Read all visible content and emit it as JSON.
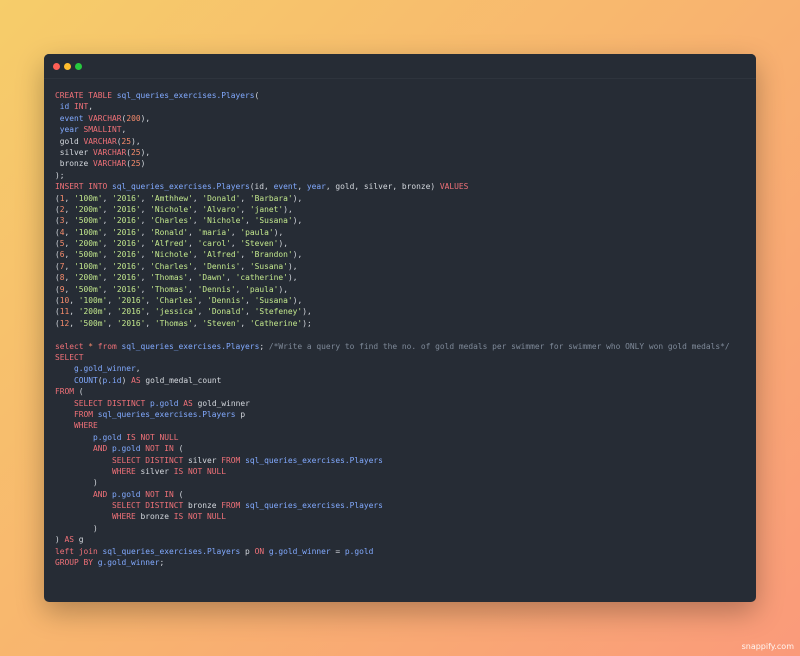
{
  "window": {
    "controls": [
      {
        "name": "close-dot",
        "color": "#ff5f56"
      },
      {
        "name": "minimize-dot",
        "color": "#ffbd2e"
      },
      {
        "name": "zoom-dot",
        "color": "#27c93f"
      }
    ]
  },
  "palette": {
    "k": "#f07178",
    "i": "#82aaff",
    "t": "#d4d8de",
    "s": "#c3e88d",
    "n": "#f78c6c",
    "c": "#7f8a99"
  },
  "code_lines": [
    [
      [
        "k",
        "CREATE TABLE "
      ],
      [
        "i",
        "sql_queries_exercises.Players"
      ],
      [
        "t",
        "("
      ]
    ],
    [
      [
        "t",
        " "
      ],
      [
        "i",
        "id "
      ],
      [
        "k",
        "INT"
      ],
      [
        "t",
        ","
      ]
    ],
    [
      [
        "t",
        " "
      ],
      [
        "i",
        "event "
      ],
      [
        "k",
        "VARCHAR"
      ],
      [
        "t",
        "("
      ],
      [
        "n",
        "200"
      ],
      [
        "t",
        "),"
      ]
    ],
    [
      [
        "t",
        " "
      ],
      [
        "i",
        "year "
      ],
      [
        "k",
        "SMALLINT"
      ],
      [
        "t",
        ","
      ]
    ],
    [
      [
        "t",
        " gold "
      ],
      [
        "k",
        "VARCHAR"
      ],
      [
        "t",
        "("
      ],
      [
        "n",
        "25"
      ],
      [
        "t",
        "),"
      ]
    ],
    [
      [
        "t",
        " silver "
      ],
      [
        "k",
        "VARCHAR"
      ],
      [
        "t",
        "("
      ],
      [
        "n",
        "25"
      ],
      [
        "t",
        "),"
      ]
    ],
    [
      [
        "t",
        " bronze "
      ],
      [
        "k",
        "VARCHAR"
      ],
      [
        "t",
        "("
      ],
      [
        "n",
        "25"
      ],
      [
        "t",
        ")"
      ]
    ],
    [
      [
        "t",
        ");"
      ]
    ],
    [
      [
        "k",
        "INSERT INTO "
      ],
      [
        "i",
        "sql_queries_exercises.Players"
      ],
      [
        "t",
        "(id, "
      ],
      [
        "i",
        "event"
      ],
      [
        "t",
        ", "
      ],
      [
        "i",
        "year"
      ],
      [
        "t",
        ", gold, silver, bronze) "
      ],
      [
        "k",
        "VALUES"
      ]
    ],
    [
      [
        "t",
        "("
      ],
      [
        "n",
        "1"
      ],
      [
        "t",
        ", "
      ],
      [
        "s",
        "'100m'"
      ],
      [
        "t",
        ", "
      ],
      [
        "s",
        "'2016'"
      ],
      [
        "t",
        ", "
      ],
      [
        "s",
        "'Amthhew'"
      ],
      [
        "t",
        ", "
      ],
      [
        "s",
        "'Donald'"
      ],
      [
        "t",
        ", "
      ],
      [
        "s",
        "'Barbara'"
      ],
      [
        "t",
        "),"
      ]
    ],
    [
      [
        "t",
        "("
      ],
      [
        "n",
        "2"
      ],
      [
        "t",
        ", "
      ],
      [
        "s",
        "'200m'"
      ],
      [
        "t",
        ", "
      ],
      [
        "s",
        "'2016'"
      ],
      [
        "t",
        ", "
      ],
      [
        "s",
        "'Nichole'"
      ],
      [
        "t",
        ", "
      ],
      [
        "s",
        "'Alvaro'"
      ],
      [
        "t",
        ", "
      ],
      [
        "s",
        "'janet'"
      ],
      [
        "t",
        "),"
      ]
    ],
    [
      [
        "t",
        "("
      ],
      [
        "n",
        "3"
      ],
      [
        "t",
        ", "
      ],
      [
        "s",
        "'500m'"
      ],
      [
        "t",
        ", "
      ],
      [
        "s",
        "'2016'"
      ],
      [
        "t",
        ", "
      ],
      [
        "s",
        "'Charles'"
      ],
      [
        "t",
        ", "
      ],
      [
        "s",
        "'Nichole'"
      ],
      [
        "t",
        ", "
      ],
      [
        "s",
        "'Susana'"
      ],
      [
        "t",
        "),"
      ]
    ],
    [
      [
        "t",
        "("
      ],
      [
        "n",
        "4"
      ],
      [
        "t",
        ", "
      ],
      [
        "s",
        "'100m'"
      ],
      [
        "t",
        ", "
      ],
      [
        "s",
        "'2016'"
      ],
      [
        "t",
        ", "
      ],
      [
        "s",
        "'Ronald'"
      ],
      [
        "t",
        ", "
      ],
      [
        "s",
        "'maria'"
      ],
      [
        "t",
        ", "
      ],
      [
        "s",
        "'paula'"
      ],
      [
        "t",
        "),"
      ]
    ],
    [
      [
        "t",
        "("
      ],
      [
        "n",
        "5"
      ],
      [
        "t",
        ", "
      ],
      [
        "s",
        "'200m'"
      ],
      [
        "t",
        ", "
      ],
      [
        "s",
        "'2016'"
      ],
      [
        "t",
        ", "
      ],
      [
        "s",
        "'Alfred'"
      ],
      [
        "t",
        ", "
      ],
      [
        "s",
        "'carol'"
      ],
      [
        "t",
        ", "
      ],
      [
        "s",
        "'Steven'"
      ],
      [
        "t",
        "),"
      ]
    ],
    [
      [
        "t",
        "("
      ],
      [
        "n",
        "6"
      ],
      [
        "t",
        ", "
      ],
      [
        "s",
        "'500m'"
      ],
      [
        "t",
        ", "
      ],
      [
        "s",
        "'2016'"
      ],
      [
        "t",
        ", "
      ],
      [
        "s",
        "'Nichole'"
      ],
      [
        "t",
        ", "
      ],
      [
        "s",
        "'Alfred'"
      ],
      [
        "t",
        ", "
      ],
      [
        "s",
        "'Brandon'"
      ],
      [
        "t",
        "),"
      ]
    ],
    [
      [
        "t",
        "("
      ],
      [
        "n",
        "7"
      ],
      [
        "t",
        ", "
      ],
      [
        "s",
        "'100m'"
      ],
      [
        "t",
        ", "
      ],
      [
        "s",
        "'2016'"
      ],
      [
        "t",
        ", "
      ],
      [
        "s",
        "'Charles'"
      ],
      [
        "t",
        ", "
      ],
      [
        "s",
        "'Dennis'"
      ],
      [
        "t",
        ", "
      ],
      [
        "s",
        "'Susana'"
      ],
      [
        "t",
        "),"
      ]
    ],
    [
      [
        "t",
        "("
      ],
      [
        "n",
        "8"
      ],
      [
        "t",
        ", "
      ],
      [
        "s",
        "'200m'"
      ],
      [
        "t",
        ", "
      ],
      [
        "s",
        "'2016'"
      ],
      [
        "t",
        ", "
      ],
      [
        "s",
        "'Thomas'"
      ],
      [
        "t",
        ", "
      ],
      [
        "s",
        "'Dawn'"
      ],
      [
        "t",
        ", "
      ],
      [
        "s",
        "'catherine'"
      ],
      [
        "t",
        "),"
      ]
    ],
    [
      [
        "t",
        "("
      ],
      [
        "n",
        "9"
      ],
      [
        "t",
        ", "
      ],
      [
        "s",
        "'500m'"
      ],
      [
        "t",
        ", "
      ],
      [
        "s",
        "'2016'"
      ],
      [
        "t",
        ", "
      ],
      [
        "s",
        "'Thomas'"
      ],
      [
        "t",
        ", "
      ],
      [
        "s",
        "'Dennis'"
      ],
      [
        "t",
        ", "
      ],
      [
        "s",
        "'paula'"
      ],
      [
        "t",
        "),"
      ]
    ],
    [
      [
        "t",
        "("
      ],
      [
        "n",
        "10"
      ],
      [
        "t",
        ", "
      ],
      [
        "s",
        "'100m'"
      ],
      [
        "t",
        ", "
      ],
      [
        "s",
        "'2016'"
      ],
      [
        "t",
        ", "
      ],
      [
        "s",
        "'Charles'"
      ],
      [
        "t",
        ", "
      ],
      [
        "s",
        "'Dennis'"
      ],
      [
        "t",
        ", "
      ],
      [
        "s",
        "'Susana'"
      ],
      [
        "t",
        "),"
      ]
    ],
    [
      [
        "t",
        "("
      ],
      [
        "n",
        "11"
      ],
      [
        "t",
        ", "
      ],
      [
        "s",
        "'200m'"
      ],
      [
        "t",
        ", "
      ],
      [
        "s",
        "'2016'"
      ],
      [
        "t",
        ", "
      ],
      [
        "s",
        "'jessica'"
      ],
      [
        "t",
        ", "
      ],
      [
        "s",
        "'Donald'"
      ],
      [
        "t",
        ", "
      ],
      [
        "s",
        "'Stefeney'"
      ],
      [
        "t",
        "),"
      ]
    ],
    [
      [
        "t",
        "("
      ],
      [
        "n",
        "12"
      ],
      [
        "t",
        ", "
      ],
      [
        "s",
        "'500m'"
      ],
      [
        "t",
        ", "
      ],
      [
        "s",
        "'2016'"
      ],
      [
        "t",
        ", "
      ],
      [
        "s",
        "'Thomas'"
      ],
      [
        "t",
        ", "
      ],
      [
        "s",
        "'Steven'"
      ],
      [
        "t",
        ", "
      ],
      [
        "s",
        "'Catherine'"
      ],
      [
        "t",
        ");"
      ]
    ],
    [],
    [
      [
        "k",
        "select "
      ],
      [
        "n",
        "* "
      ],
      [
        "k",
        "from "
      ],
      [
        "i",
        "sql_queries_exercises.Players"
      ],
      [
        "t",
        "; "
      ],
      [
        "c",
        "/*Write a query to find the no. of gold medals per swimmer for swimmer who ONLY won gold medals*/"
      ]
    ],
    [
      [
        "k",
        "SELECT"
      ]
    ],
    [
      [
        "t",
        "    "
      ],
      [
        "i",
        "g.gold_winner"
      ],
      [
        "t",
        ","
      ]
    ],
    [
      [
        "t",
        "    "
      ],
      [
        "i",
        "COUNT"
      ],
      [
        "t",
        "("
      ],
      [
        "i",
        "p.id"
      ],
      [
        "t",
        ") "
      ],
      [
        "k",
        "AS "
      ],
      [
        "t",
        "gold_medal_count"
      ]
    ],
    [
      [
        "k",
        "FROM "
      ],
      [
        "t",
        "("
      ]
    ],
    [
      [
        "t",
        "    "
      ],
      [
        "k",
        "SELECT DISTINCT "
      ],
      [
        "i",
        "p.gold "
      ],
      [
        "k",
        "AS "
      ],
      [
        "t",
        "gold_winner"
      ]
    ],
    [
      [
        "t",
        "    "
      ],
      [
        "k",
        "FROM "
      ],
      [
        "i",
        "sql_queries_exercises.Players "
      ],
      [
        "t",
        "p"
      ]
    ],
    [
      [
        "t",
        "    "
      ],
      [
        "k",
        "WHERE"
      ]
    ],
    [
      [
        "t",
        "        "
      ],
      [
        "i",
        "p.gold "
      ],
      [
        "k",
        "IS NOT NULL"
      ]
    ],
    [
      [
        "t",
        "        "
      ],
      [
        "k",
        "AND "
      ],
      [
        "i",
        "p.gold "
      ],
      [
        "k",
        "NOT IN "
      ],
      [
        "t",
        "("
      ]
    ],
    [
      [
        "t",
        "            "
      ],
      [
        "k",
        "SELECT DISTINCT "
      ],
      [
        "t",
        "silver "
      ],
      [
        "k",
        "FROM "
      ],
      [
        "i",
        "sql_queries_exercises.Players"
      ]
    ],
    [
      [
        "t",
        "            "
      ],
      [
        "k",
        "WHERE "
      ],
      [
        "t",
        "silver "
      ],
      [
        "k",
        "IS NOT NULL"
      ]
    ],
    [
      [
        "t",
        "        )"
      ]
    ],
    [
      [
        "t",
        "        "
      ],
      [
        "k",
        "AND "
      ],
      [
        "i",
        "p.gold "
      ],
      [
        "k",
        "NOT IN "
      ],
      [
        "t",
        "("
      ]
    ],
    [
      [
        "t",
        "            "
      ],
      [
        "k",
        "SELECT DISTINCT "
      ],
      [
        "t",
        "bronze "
      ],
      [
        "k",
        "FROM "
      ],
      [
        "i",
        "sql_queries_exercises.Players"
      ]
    ],
    [
      [
        "t",
        "            "
      ],
      [
        "k",
        "WHERE "
      ],
      [
        "t",
        "bronze "
      ],
      [
        "k",
        "IS NOT NULL"
      ]
    ],
    [
      [
        "t",
        "        )"
      ]
    ],
    [
      [
        "t",
        ") "
      ],
      [
        "k",
        "AS "
      ],
      [
        "t",
        "g"
      ]
    ],
    [
      [
        "k",
        "left join "
      ],
      [
        "i",
        "sql_queries_exercises.Players "
      ],
      [
        "t",
        "p "
      ],
      [
        "k",
        "ON "
      ],
      [
        "i",
        "g.gold_winner "
      ],
      [
        "t",
        "= "
      ],
      [
        "i",
        "p.gold"
      ]
    ],
    [
      [
        "k",
        "GROUP BY "
      ],
      [
        "i",
        "g.gold_winner"
      ],
      [
        "t",
        ";"
      ]
    ]
  ],
  "watermark": "snappify.com"
}
